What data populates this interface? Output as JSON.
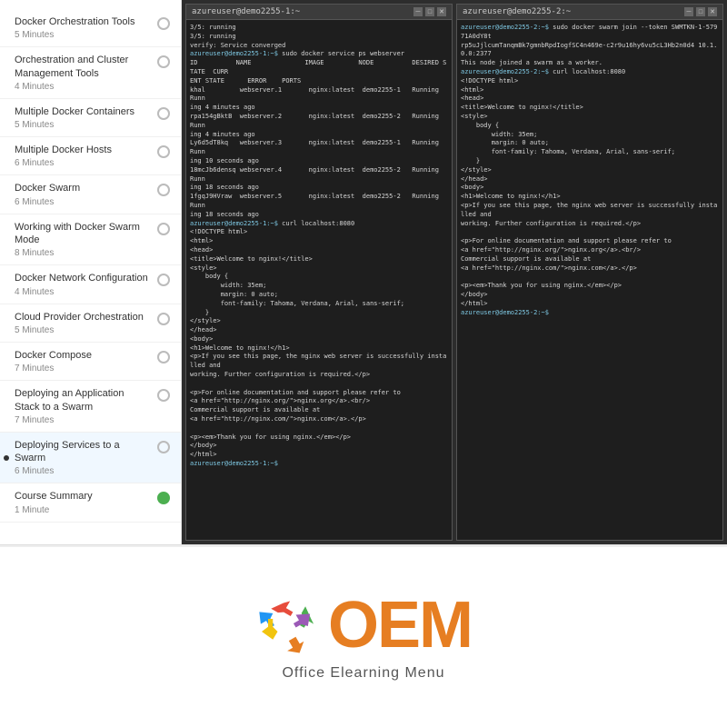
{
  "sidebar": {
    "items": [
      {
        "id": "docker-orchestration",
        "label": "Docker Orchestration Tools",
        "duration": "5 Minutes",
        "icon": "empty",
        "active": false
      },
      {
        "id": "orchestration-cluster",
        "label": "Orchestration and Cluster Management Tools",
        "duration": "4 Minutes",
        "icon": "empty",
        "active": false
      },
      {
        "id": "multiple-containers",
        "label": "Multiple Docker Containers",
        "duration": "5 Minutes",
        "icon": "empty",
        "active": false
      },
      {
        "id": "multiple-hosts",
        "label": "Multiple Docker Hosts",
        "duration": "6 Minutes",
        "icon": "empty",
        "active": false
      },
      {
        "id": "docker-swarm",
        "label": "Docker Swarm",
        "duration": "6 Minutes",
        "icon": "empty",
        "active": false
      },
      {
        "id": "working-swarm-mode",
        "label": "Working with Docker Swarm Mode",
        "duration": "8 Minutes",
        "icon": "empty",
        "active": false
      },
      {
        "id": "docker-network",
        "label": "Docker Network Configuration",
        "duration": "4 Minutes",
        "icon": "empty",
        "active": false
      },
      {
        "id": "cloud-provider",
        "label": "Cloud Provider Orchestration",
        "duration": "5 Minutes",
        "icon": "empty",
        "active": false
      },
      {
        "id": "docker-compose",
        "label": "Docker Compose",
        "duration": "7 Minutes",
        "icon": "empty",
        "active": false
      },
      {
        "id": "deploying-app-stack",
        "label": "Deploying an Application Stack to a Swarm",
        "duration": "7 Minutes",
        "icon": "empty",
        "active": false
      },
      {
        "id": "deploying-services",
        "label": "Deploying Services to a Swarm",
        "duration": "6 Minutes",
        "icon": "empty",
        "active": true
      },
      {
        "id": "course-summary",
        "label": "Course Summary",
        "duration": "1 Minute",
        "icon": "green",
        "active": false
      }
    ]
  },
  "terminal": {
    "left": {
      "title": "azureuser@demo2255-1:~",
      "content": "3/5: running\n3/5: running\nverify: Service converged\nazureuser@demo2255-1:~$ sudo docker service ps webserver\nID          NAME              IMAGE         NODE          DESIRED STATE  CURR\nENT STATE      ERROR    PORTS\nkhal         webserver.1       nginx:latest  demo2255-1   Running       Runn\ning 4 minutes ago\nrpa154gBktB  webserver.2       nginx:latest  demo2255-2   Running       Runn\ning 10 seconds ago\nLy6d5dT8kq   webserver.3       nginx:latest  demo2255-1   Running       Runn\ning 18 seconds ago\n18mcJb6densq webserver.4       nginx:latest  demo2255-2   Running       Runn\ning 18 seconds ago\n1fgqJ9HVraw  webserver.5       nginx:latest  demo2255-2   Running       Runn\ning 18 seconds ago\nazureuser@demo2255-1:~$ curl localhost:8080\n<!DOCTYPE html>\n<html>\n<head>\n<title>Welcome to nginx!</title>\n<style>\n    body {\n        width: 35em;\n        margin: 0 auto;\n        font-family: Tahoma, Verdana, Arial, sans-serif;\n    }\n</style>\n</head>\n<body>\n<h1>Welcome to nginx!</h1>\n<p>If you see this page, the nginx web server is successfully installed and\nworking. Further configuration is required.</p>\n\n<p>For online documentation and support please refer to\n<a href=\"http://nginx.org/\">nginx.org</a>.<br/>\nCommercial support is available at\n<a href=\"http://nginx.com/\">nginx.com</a>.</p>\n\n<p><em>Thank you for using nginx.</em></p>\n</body>\n</html>\nazureuser@demo2255-1:~$"
    },
    "right": {
      "title": "azureuser@demo2255-2:~",
      "content": "$ sudo docker swarm join --token SWMTKN-1-57971A0dY8t\nrp5uJjlcumTanqmBk7gmnbRpdIogfSC4n469e-c2r9u16hy6vu5cL3Hb2n0d4 10.1.0.0:2377\nThis node joined a swarm as a worker.\nazureuser@demo2255-2:~$ curl localhost:8080\n<!DOCTYPE html>\n<html>\n<head>\n<title>Welcome to nginx!</title>\n<style>\n    body {\n        width: 35em;\n        margin: 0 auto;\n        font-family: Tahoma, Verdana, Arial, sans-serif;\n    }\n</style>\n</head>\n<body>\n<h1>Welcome to nginx!</h1>\n<p>If you see this page, the nginx web server is successfully installed and\nworking. Further configuration is required.</p>\n\n<p>For online documentation and support please refer to\n<a href=\"http://nginx.org/\">nginx.org</a>.<br/>\nCommercial support is available at\n<a href=\"http://nginx.com/\">nginx.com</a>.</p>\n\n<p><em>Thank you for using nginx.</em></p>\n</body>\n</html>\nazureuser@demo2255-2:~$"
    }
  },
  "oem": {
    "title": "OEM",
    "subtitle": "Office Elearning Menu"
  }
}
